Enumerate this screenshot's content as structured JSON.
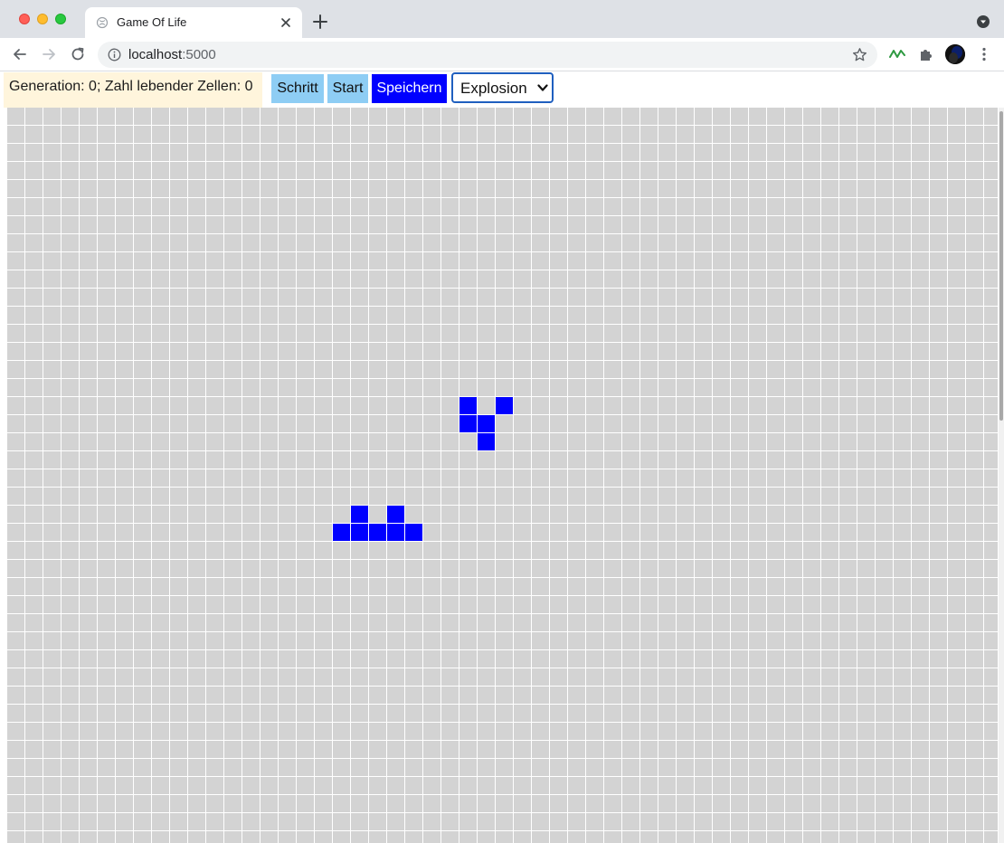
{
  "browser": {
    "tab_title": "Game Of Life",
    "url_host": "localhost",
    "url_port": ":5000"
  },
  "icons": {
    "tab_favicon": "globe-icon",
    "tab_close": "close-icon",
    "new_tab": "plus-icon",
    "tab_search": "chevron-down-circle-icon",
    "back": "arrow-left-icon",
    "forward": "arrow-right-icon",
    "reload": "reload-icon",
    "site_info": "info-icon",
    "bookmark": "star-icon",
    "extension_1": "green-wave-icon",
    "extensions": "puzzle-icon",
    "menu": "kebab-menu-icon"
  },
  "status": {
    "text": "Generation: 0; Zahl lebender Zellen: 0"
  },
  "controls": {
    "step_label": "Schritt",
    "start_label": "Start",
    "save_label": "Speichern",
    "pattern_selected": "Explosion"
  },
  "colors": {
    "alive": "#0000ff",
    "dead": "#d3d3d3",
    "grid_line": "#ffffff",
    "status_bg": "#fff5dc",
    "button_light": "#8ecdf4",
    "button_dark": "#0000ff"
  },
  "board": {
    "columns": 55,
    "rows": 41,
    "alive_cells": [
      [
        25,
        16
      ],
      [
        27,
        16
      ],
      [
        25,
        17
      ],
      [
        26,
        17
      ],
      [
        26,
        18
      ],
      [
        19,
        22
      ],
      [
        21,
        22
      ],
      [
        18,
        23
      ],
      [
        19,
        23
      ],
      [
        20,
        23
      ],
      [
        21,
        23
      ],
      [
        22,
        23
      ]
    ]
  }
}
